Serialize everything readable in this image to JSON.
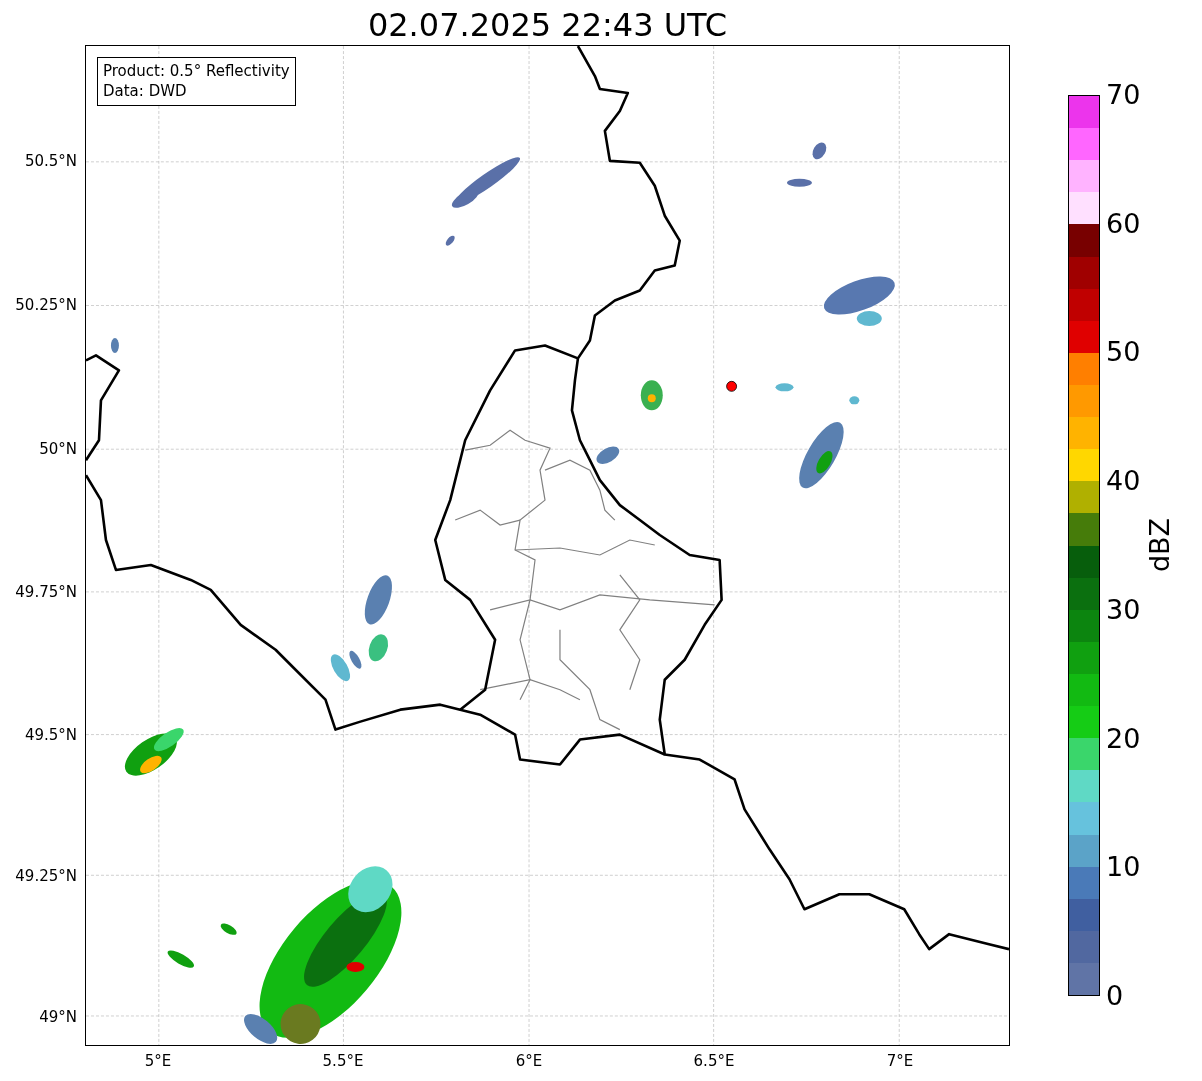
{
  "title": "02.07.2025 22:43 UTC",
  "map": {
    "info_box": [
      "Product: 0.5° Reflectivity",
      "Data: DWD"
    ],
    "lat_ticks": [
      "50.5°N",
      "50.25°N",
      "50°N",
      "49.75°N",
      "49.5°N",
      "49.25°N",
      "49°N"
    ],
    "lon_ticks": [
      "5°E",
      "5.5°E",
      "6°E",
      "6.5°E",
      "7°E"
    ]
  },
  "colorbar": {
    "label": "dBZ",
    "ticks": [
      "70",
      "60",
      "50",
      "40",
      "30",
      "20",
      "10",
      "0"
    ],
    "segments": [
      {
        "color": "#ec34ec"
      },
      {
        "color": "#ff66ff"
      },
      {
        "color": "#ffb3ff"
      },
      {
        "color": "#ffe0ff"
      },
      {
        "color": "#780000"
      },
      {
        "color": "#a00000"
      },
      {
        "color": "#c00000"
      },
      {
        "color": "#e00000"
      },
      {
        "color": "#ff7f00"
      },
      {
        "color": "#ff9900"
      },
      {
        "color": "#ffb300"
      },
      {
        "color": "#ffd700"
      },
      {
        "color": "#b0b000"
      },
      {
        "color": "#467c0a"
      },
      {
        "color": "#075e0c"
      },
      {
        "color": "#0b700f"
      },
      {
        "color": "#0c850f"
      },
      {
        "color": "#10a010"
      },
      {
        "color": "#12ba12"
      },
      {
        "color": "#15cc15"
      },
      {
        "color": "#3ad66b"
      },
      {
        "color": "#5fd9c5"
      },
      {
        "color": "#66c2dd"
      },
      {
        "color": "#5ba3c8"
      },
      {
        "color": "#4a7ab8"
      },
      {
        "color": "#405fa0"
      },
      {
        "color": "#5168a0"
      },
      {
        "color": "#6074a6"
      }
    ]
  }
}
